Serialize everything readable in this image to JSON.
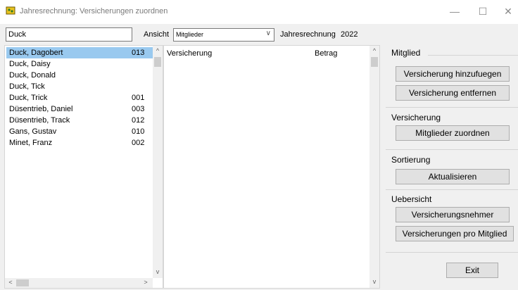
{
  "window": {
    "title": "Jahresrechnung: Versicherungen zuordnen",
    "minimize": "—",
    "maximize": "☐",
    "close": "✕"
  },
  "toolbar": {
    "search_value": "Duck",
    "ansicht_label": "Ansicht",
    "ansicht_selected": "Mitglieder",
    "jahresrechnung_label": "Jahresrechnung",
    "jahresrechnung_value": "2022"
  },
  "members": [
    {
      "name": "Duck, Dagobert",
      "num": "013",
      "selected": true
    },
    {
      "name": "Duck, Daisy",
      "num": ""
    },
    {
      "name": "Duck, Donald",
      "num": ""
    },
    {
      "name": "Duck, Tick",
      "num": ""
    },
    {
      "name": "Duck, Trick",
      "num": "001"
    },
    {
      "name": "Düsentrieb, Daniel",
      "num": "003"
    },
    {
      "name": "Düsentrieb, Track",
      "num": "012"
    },
    {
      "name": "Gans, Gustav",
      "num": "010"
    },
    {
      "name": "Minet, Franz",
      "num": "002"
    }
  ],
  "detail": {
    "col_versicherung": "Versicherung",
    "col_betrag": "Betrag"
  },
  "sections": {
    "mitglied": {
      "label": "Mitglied",
      "btn_add": "Versicherung hinzufuegen",
      "btn_remove": "Versicherung entfernen"
    },
    "versicherung": {
      "label": "Versicherung",
      "btn_assign": "Mitglieder zuordnen"
    },
    "sortierung": {
      "label": "Sortierung",
      "btn_refresh": "Aktualisieren"
    },
    "uebersicht": {
      "label": "Uebersicht",
      "btn_holders": "Versicherungsnehmer",
      "btn_per_member": "Versicherungen pro Mitglied"
    },
    "exit_label": "Exit"
  },
  "icons": {
    "up": "^",
    "down": "v",
    "left": "<",
    "right": ">",
    "chevron": "∨"
  },
  "colors": {
    "selection": "#99c9ef"
  }
}
